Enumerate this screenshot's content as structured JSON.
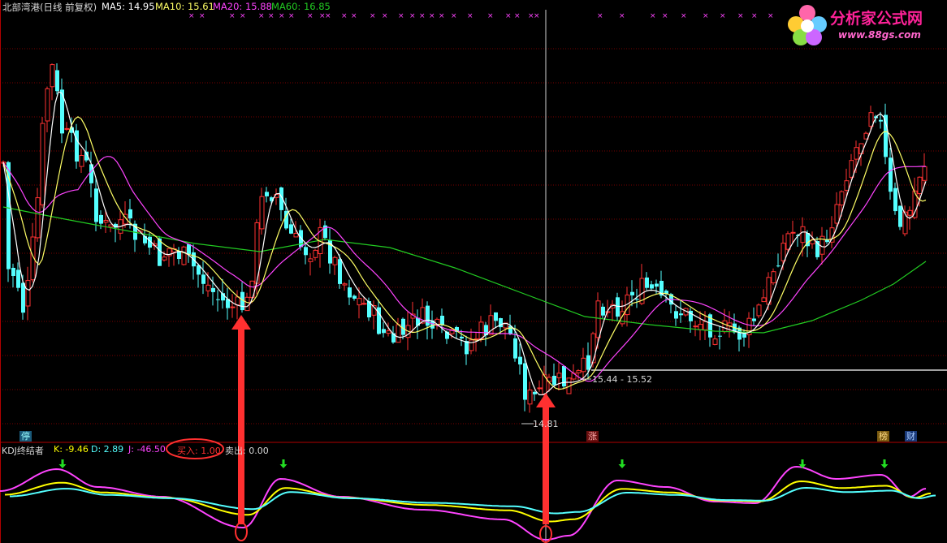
{
  "main_header": {
    "title": "北部湾港(日线 前复权)",
    "ma5": "MA5: 14.95",
    "ma10": "MA10: 15.61",
    "ma20": "MA20: 15.88",
    "ma60": "MA60: 16.85"
  },
  "logo": {
    "cn_text": "分析家公式网",
    "url_text": "www.88gs.com"
  },
  "price_annotations": {
    "range_label": "15.44 - 15.52",
    "low_label": "14.81"
  },
  "event_badges": {
    "left": "停",
    "mid": "涨",
    "right1": "榜",
    "right2": "财"
  },
  "indicator_header": {
    "name": "KDJ终结者",
    "k": "K: -9.46",
    "d": "D: 2.89",
    "j": "J: -46.50",
    "buy": "买入: 1.00",
    "sell": "卖出: 0.00"
  },
  "colors": {
    "up": "#ff3232",
    "down": "#54ffff",
    "ma5": "#ffffff",
    "ma10": "#ffff66",
    "ma20": "#ff44ff",
    "ma60": "#22cc22",
    "k_line": "#ffff00",
    "d_line": "#54ffff",
    "j_line": "#ff44ff",
    "arrow": "#ff3030",
    "sell_arrow": "#22dd22"
  },
  "chart_data": {
    "type": "candlestick",
    "ma5_last": 14.95,
    "ma10_last": 15.61,
    "ma20_last": 15.88,
    "ma60_last": 16.85,
    "marked_low": 14.81,
    "marked_range": [
      15.44,
      15.52
    ],
    "kdj": {
      "k": -9.46,
      "d": 2.89,
      "j": -46.5,
      "buy": 1.0,
      "sell": 0.0
    }
  }
}
